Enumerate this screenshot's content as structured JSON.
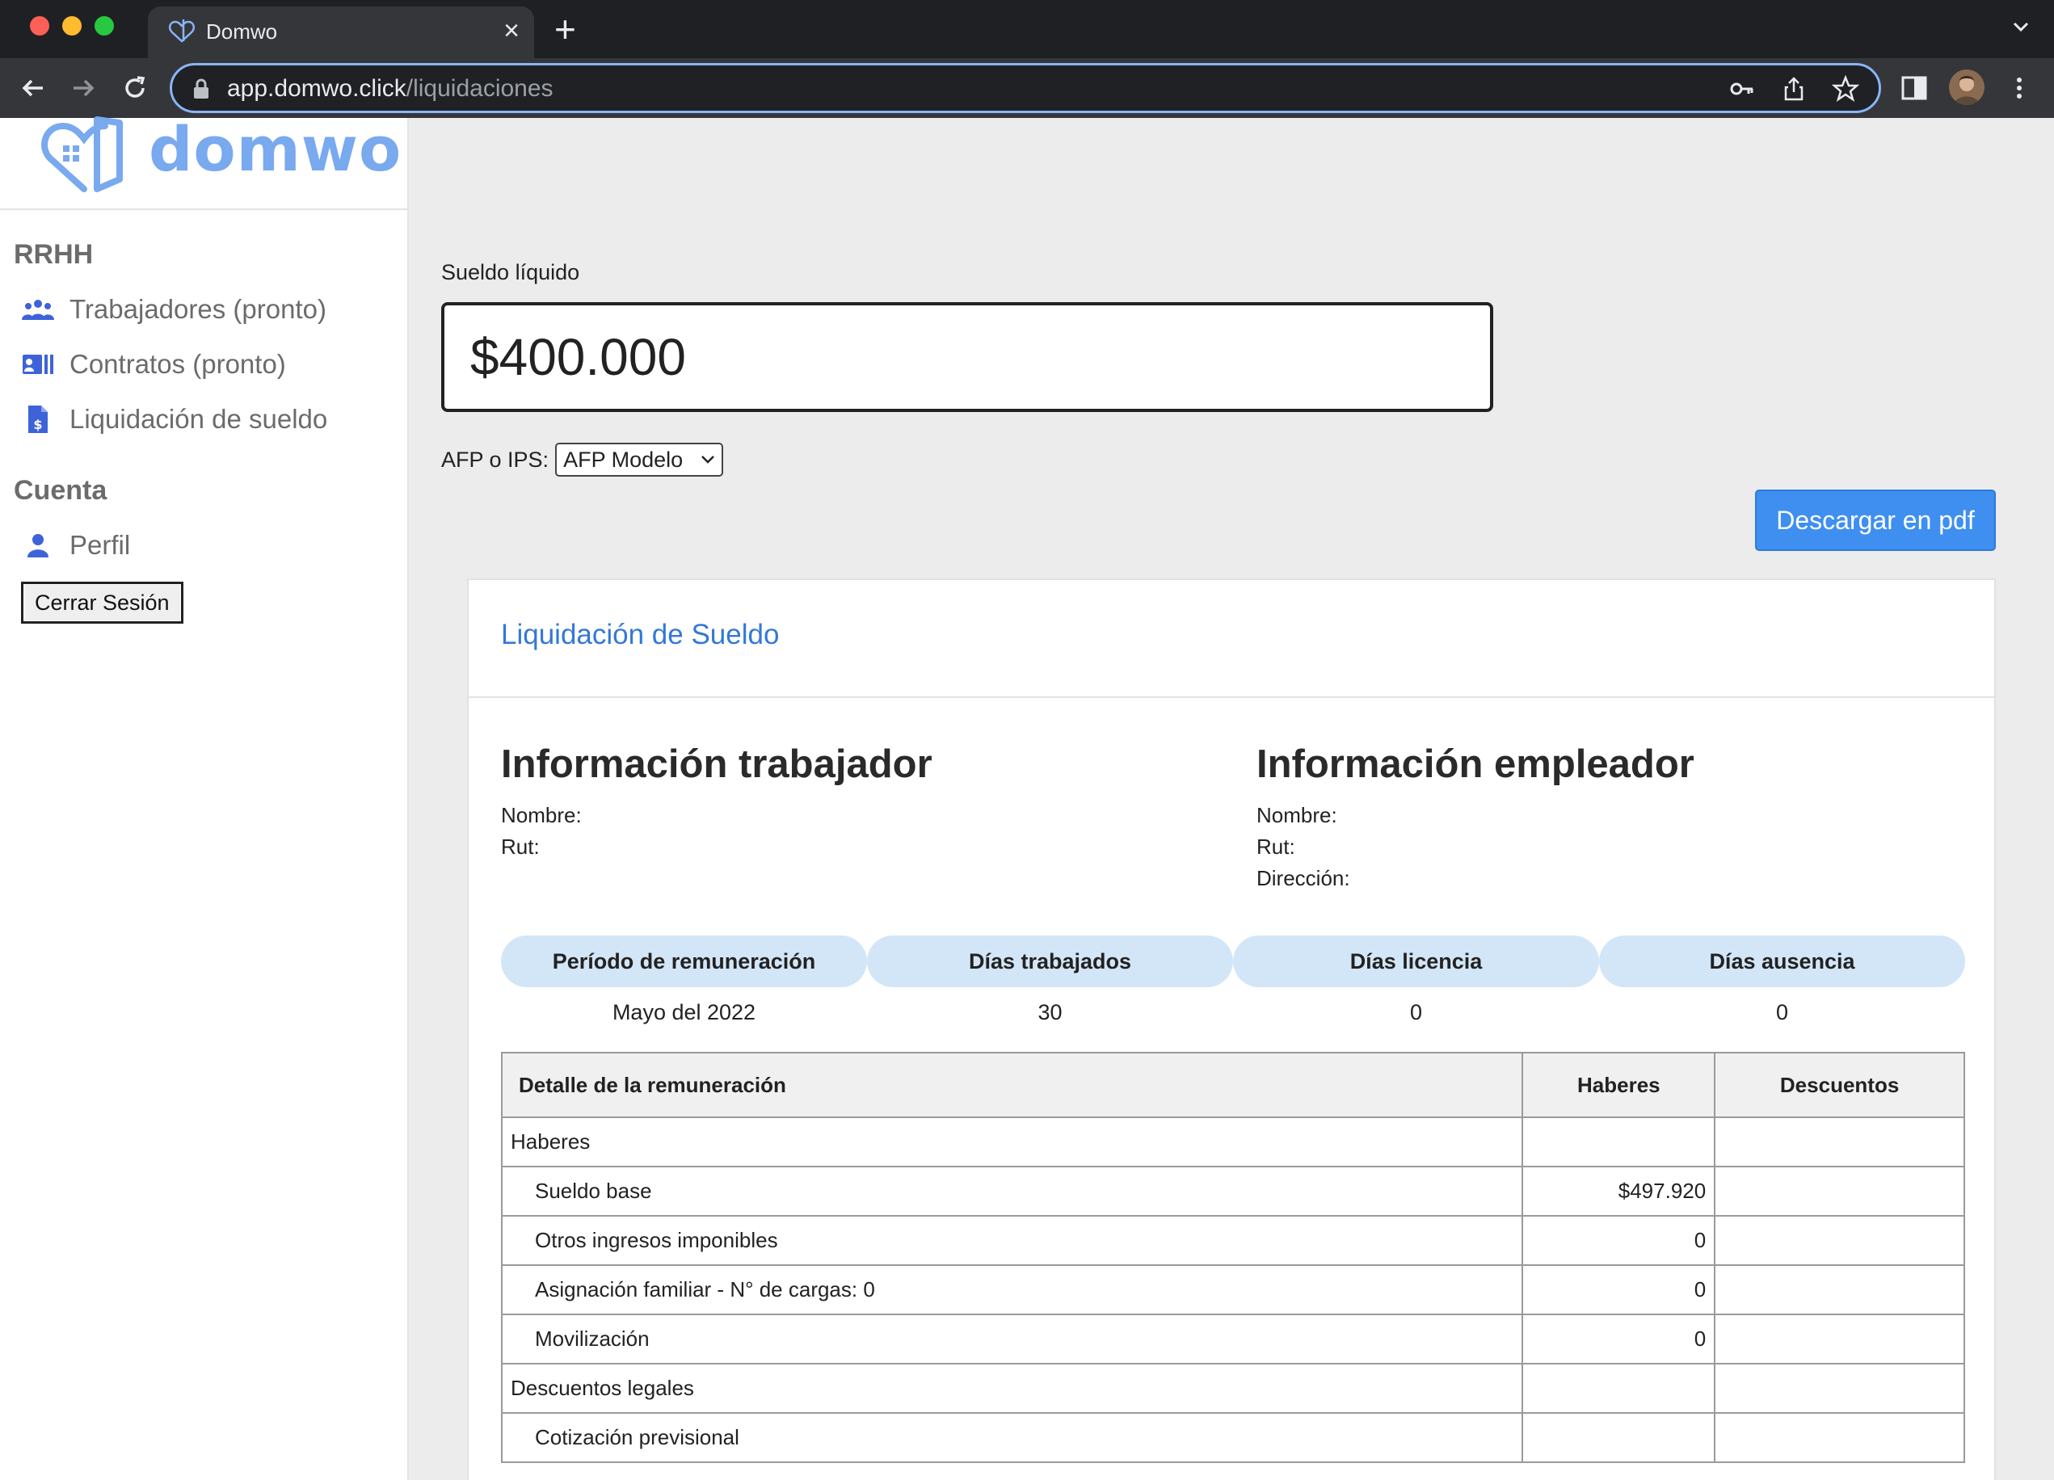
{
  "browser": {
    "tab_title": "Domwo",
    "url_host": "app.domwo.click",
    "url_path": "/liquidaciones"
  },
  "sidebar": {
    "logo_text": "domwo",
    "sections": [
      {
        "title": "RRHH"
      },
      {
        "title": "Cuenta"
      }
    ],
    "items": [
      {
        "label": "Trabajadores (pronto)",
        "icon": "users-icon"
      },
      {
        "label": "Contratos (pronto)",
        "icon": "contract-card-icon"
      },
      {
        "label": "Liquidación de sueldo",
        "icon": "invoice-dollar-icon"
      },
      {
        "label": "Perfil",
        "icon": "user-icon"
      }
    ],
    "logout_label": "Cerrar Sesión"
  },
  "form": {
    "sueldo_label": "Sueldo líquido",
    "sueldo_value": "$400.000",
    "afp_label": "AFP o IPS:",
    "afp_selected": "AFP Modelo",
    "pdf_button": "Descargar en pdf"
  },
  "liquidacion": {
    "title": "Liquidación de Sueldo",
    "trabajador": {
      "heading": "Información trabajador",
      "nombre_label": "Nombre:",
      "rut_label": "Rut:"
    },
    "empleador": {
      "heading": "Información empleador",
      "nombre_label": "Nombre:",
      "rut_label": "Rut:",
      "direccion_label": "Dirección:"
    },
    "summary_headers": [
      "Período de remuneración",
      "Días trabajados",
      "Días licencia",
      "Días ausencia"
    ],
    "summary_values": [
      "Mayo del 2022",
      "30",
      "0",
      "0"
    ],
    "table_headers": [
      "Detalle de la remuneración",
      "Haberes",
      "Descuentos"
    ],
    "rows": [
      {
        "label": "Haberes",
        "haberes": "",
        "descuentos": ""
      },
      {
        "label": "Sueldo base",
        "haberes": "$497.920",
        "descuentos": ""
      },
      {
        "label": "Otros ingresos imponibles",
        "haberes": "0",
        "descuentos": ""
      },
      {
        "label": "Asignación familiar - N° de cargas: 0",
        "haberes": "0",
        "descuentos": ""
      },
      {
        "label": "Movilización",
        "haberes": "0",
        "descuentos": ""
      },
      {
        "label": "Descuentos legales",
        "haberes": "",
        "descuentos": ""
      },
      {
        "label": "Cotización previsional",
        "haberes": "",
        "descuentos": ""
      }
    ]
  },
  "colors": {
    "brand": "#79a9ee",
    "accent": "#3e8ff0",
    "pill": "#d3e6f7",
    "link": "#3478d6"
  }
}
